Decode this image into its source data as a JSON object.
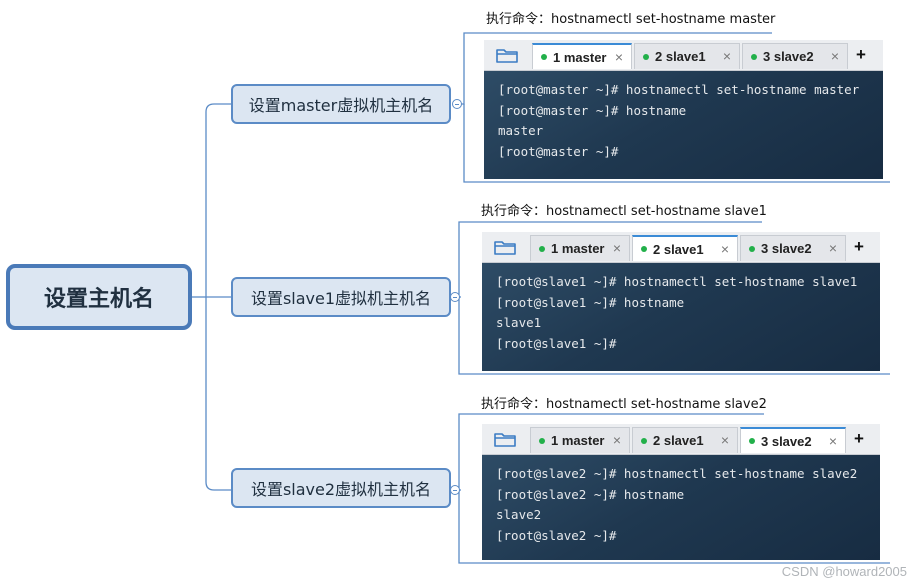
{
  "root": {
    "label": "设置主机名"
  },
  "branches": [
    {
      "label": "设置master虚拟机主机名",
      "command_label": "执行命令：hostnamectl set-hostname master",
      "tabs": [
        {
          "label": "1 master",
          "status_color": "#22b04a"
        },
        {
          "label": "2 slave1",
          "status_color": "#22b04a"
        },
        {
          "label": "3 slave2",
          "status_color": "#22b04a"
        }
      ],
      "active_tab": 0,
      "terminal_lines": [
        "[root@master ~]# hostnamectl set-hostname master",
        "[root@master ~]# hostname",
        "master",
        "[root@master ~]#"
      ]
    },
    {
      "label": "设置slave1虚拟机主机名",
      "command_label": "执行命令：hostnamectl set-hostname slave1",
      "tabs": [
        {
          "label": "1 master",
          "status_color": "#22b04a"
        },
        {
          "label": "2 slave1",
          "status_color": "#22b04a"
        },
        {
          "label": "3 slave2",
          "status_color": "#22b04a"
        }
      ],
      "active_tab": 1,
      "terminal_lines": [
        "[root@slave1 ~]# hostnamectl set-hostname slave1",
        "[root@slave1 ~]# hostname",
        "slave1",
        "[root@slave1 ~]#"
      ]
    },
    {
      "label": "设置slave2虚拟机主机名",
      "command_label": "执行命令：hostnamectl set-hostname slave2",
      "tabs": [
        {
          "label": "1 master",
          "status_color": "#22b04a"
        },
        {
          "label": "2 slave1",
          "status_color": "#22b04a"
        },
        {
          "label": "3 slave2",
          "status_color": "#22b04a"
        }
      ],
      "active_tab": 2,
      "terminal_lines": [
        "[root@slave2 ~]# hostnamectl set-hostname slave2",
        "[root@slave2 ~]# hostname",
        "slave2",
        "[root@slave2 ~]#"
      ]
    }
  ],
  "icons": {
    "folder": "folder-icon",
    "tab_close": "close-icon",
    "tab_add": "plus-icon"
  },
  "glyphs": {
    "close": "×",
    "add": "+"
  },
  "colors": {
    "node_border": "#4a7ab8",
    "node_fill": "#dce6f2",
    "tab_accent": "#3b8bd6",
    "status_dot": "#22b04a"
  },
  "watermark": "CSDN @howard2005"
}
